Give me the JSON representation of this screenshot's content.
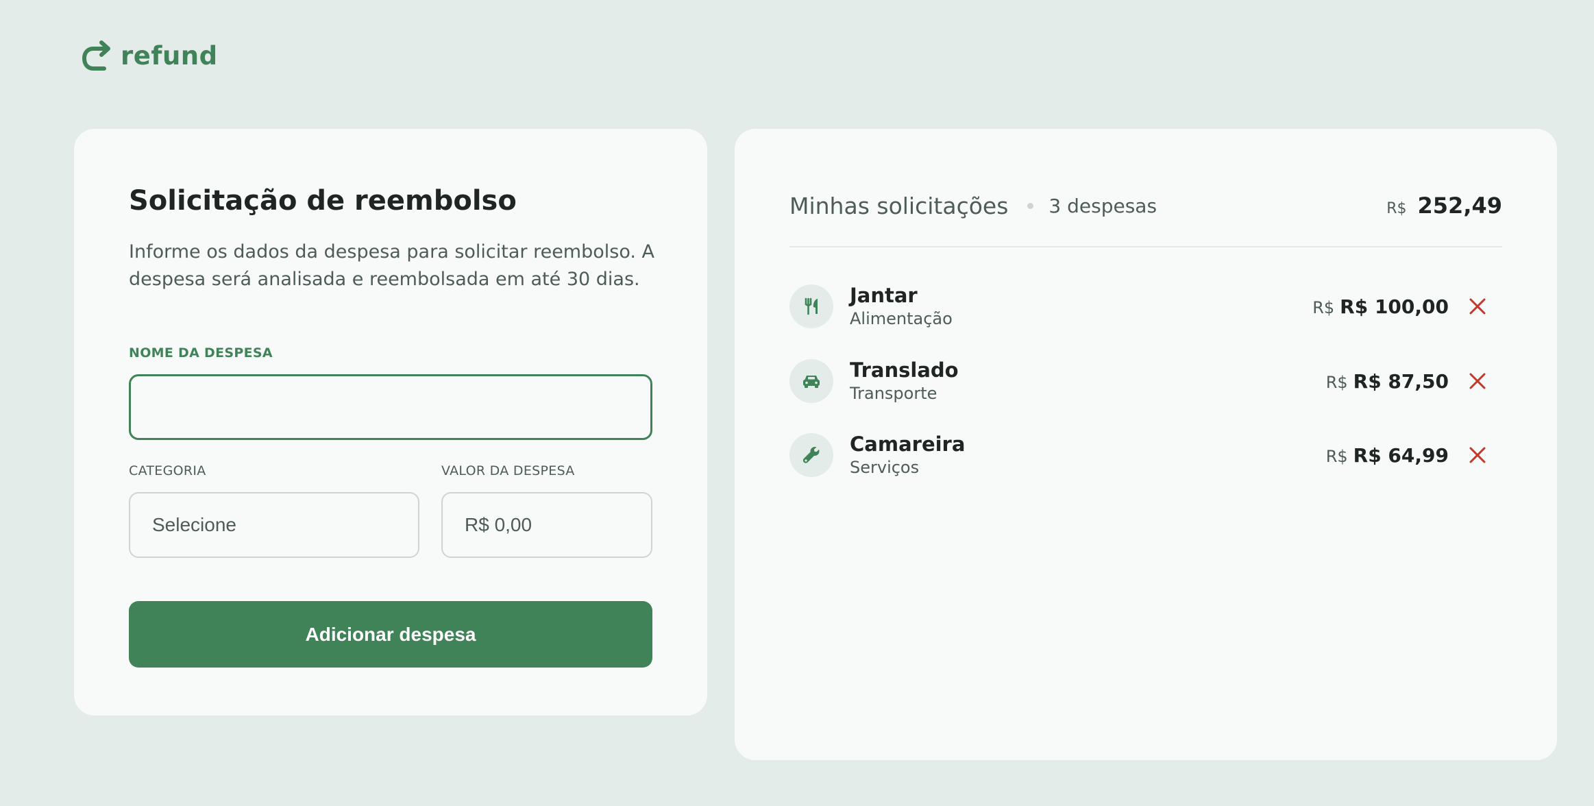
{
  "app": {
    "logo_text": "refund",
    "logo_icon": "arrow-redo-icon",
    "brand_color": "#408359"
  },
  "form": {
    "title": "Solicitação de reembolso",
    "description": "Informe os dados da despesa para solicitar reembolso. A despesa será analisada e reembolsada em até 30 dias.",
    "name_label": "NOME DA DESPESA",
    "name_value": "",
    "category_label": "CATEGORIA",
    "category_selected": "Selecione",
    "amount_label": "VALOR DA DESPESA",
    "amount_placeholder": "R$ 0,00",
    "submit_label": "Adicionar despesa"
  },
  "list": {
    "title": "Minhas solicitações",
    "count_text": "3 despesas",
    "total_currency": "R$",
    "total_value": "252,49",
    "items": [
      {
        "name": "Jantar",
        "category": "Alimentação",
        "currency": "R$",
        "amount": "R$ 100,00",
        "icon": "fork-knife-icon"
      },
      {
        "name": "Translado",
        "category": "Transporte",
        "currency": "R$",
        "amount": "R$ 87,50",
        "icon": "car-icon"
      },
      {
        "name": "Camareira",
        "category": "Serviços",
        "currency": "R$",
        "amount": "R$ 64,99",
        "icon": "wrench-icon"
      }
    ],
    "remove_icon": "close-icon",
    "remove_color": "#c0392b"
  }
}
